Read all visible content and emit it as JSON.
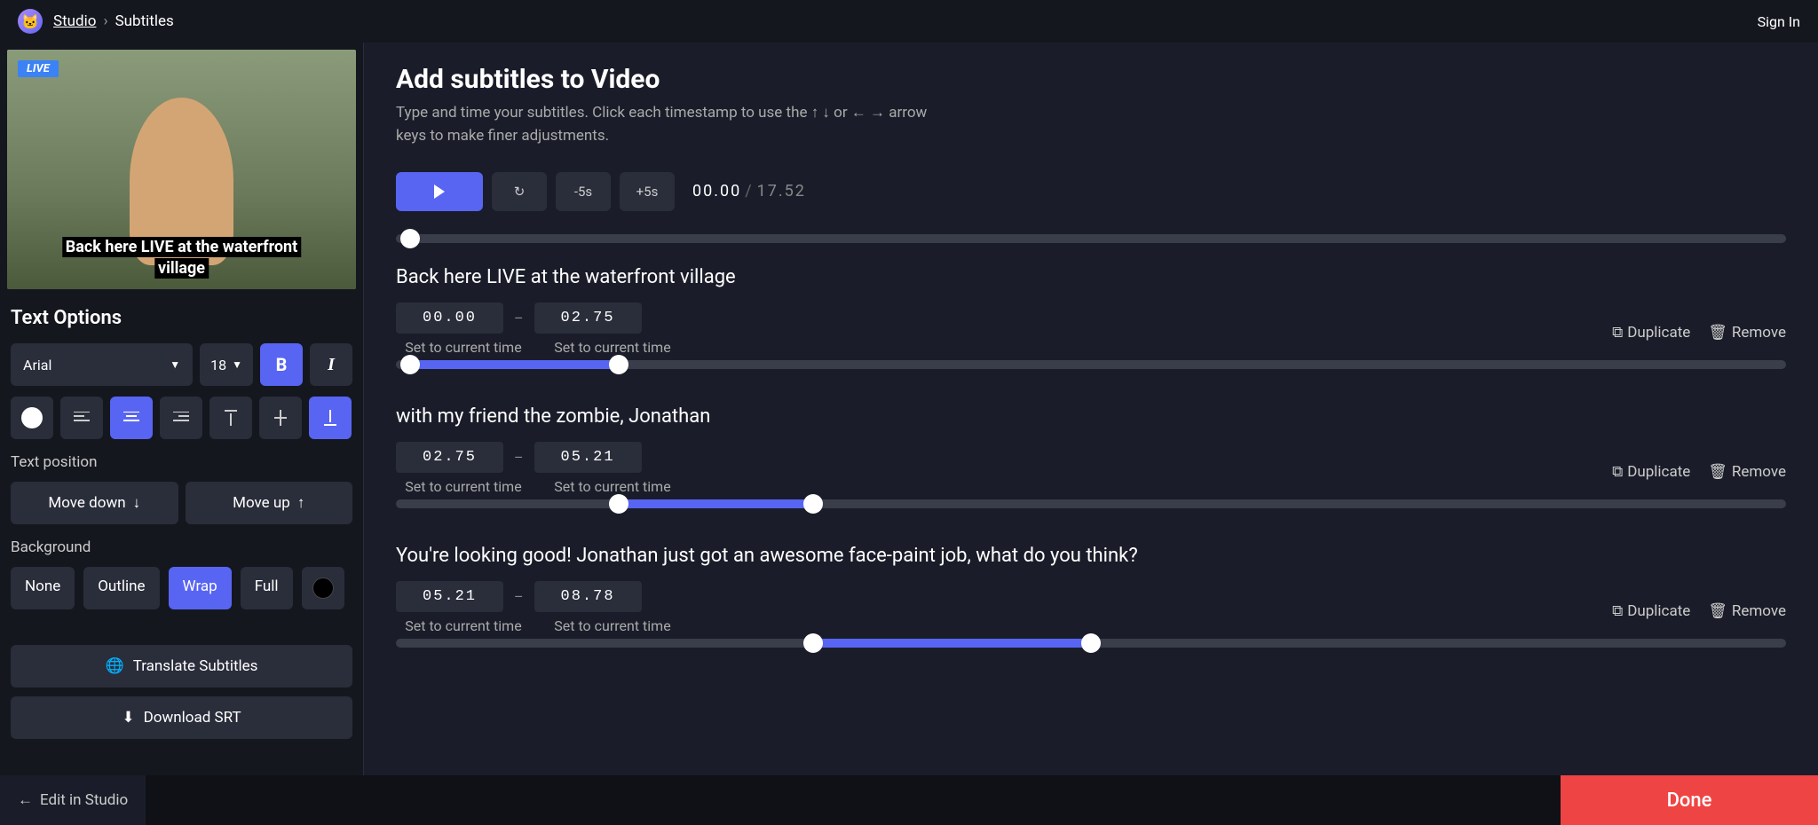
{
  "breadcrumb": {
    "root": "Studio",
    "current": "Subtitles"
  },
  "sign_in": "Sign In",
  "preview": {
    "live": "LIVE",
    "subtitle_line1": "Back here LIVE at the waterfront",
    "subtitle_line2": "village"
  },
  "text_options": {
    "title": "Text Options",
    "font": "Arial",
    "size": "18",
    "position_label": "Text position",
    "move_down": "Move down",
    "move_up": "Move up",
    "background_label": "Background",
    "bg_none": "None",
    "bg_outline": "Outline",
    "bg_wrap": "Wrap",
    "bg_full": "Full",
    "text_color": "#ffffff",
    "bg_color": "#000000",
    "translate": "Translate Subtitles",
    "download": "Download SRT"
  },
  "header": {
    "title": "Add subtitles to Video",
    "desc": "Type and time your subtitles. Click each timestamp to use the ↑ ↓ or ← → arrow keys to make finer adjustments."
  },
  "playback": {
    "minus": "-5s",
    "plus": "+5s",
    "current": "00.00",
    "duration": "17.52",
    "position_pct": 1
  },
  "set_current": "Set to current time",
  "duplicate": "Duplicate",
  "remove": "Remove",
  "subtitles": [
    {
      "text": "Back here LIVE at the waterfront village",
      "start": "00.00",
      "end": "02.75",
      "start_pct": 1,
      "end_pct": 16
    },
    {
      "text": "with my friend the zombie, Jonathan",
      "start": "02.75",
      "end": "05.21",
      "start_pct": 16,
      "end_pct": 30
    },
    {
      "text": "You're looking good! Jonathan just got an awesome face-paint job, what do you think?",
      "start": "05.21",
      "end": "08.78",
      "start_pct": 30,
      "end_pct": 50
    }
  ],
  "footer": {
    "back": "Edit in Studio",
    "done": "Done"
  }
}
